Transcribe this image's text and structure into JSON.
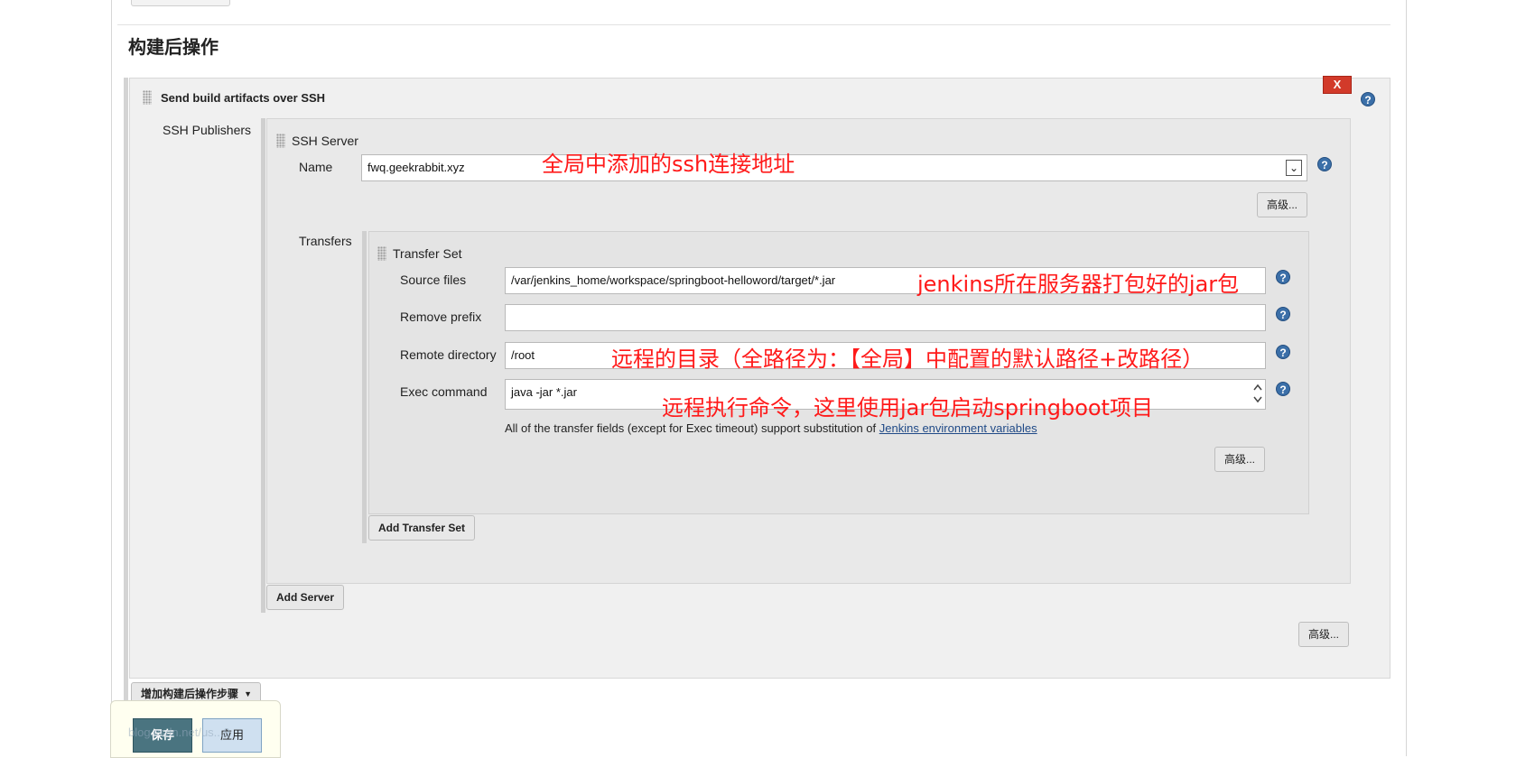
{
  "section": {
    "title": "构建后操作"
  },
  "step": {
    "title": "Send build artifacts over SSH",
    "delete_label": "X"
  },
  "publishers": {
    "label": "SSH Publishers"
  },
  "server": {
    "header": "SSH Server",
    "name_label": "Name",
    "name_value": "fwq.geekrabbit.xyz",
    "advanced_label": "高级..."
  },
  "transfers": {
    "label": "Transfers",
    "set_header": "Transfer Set",
    "source_files_label": "Source files",
    "source_files_value": "/var/jenkins_home/workspace/springboot-helloword/target/*.jar",
    "remove_prefix_label": "Remove prefix",
    "remove_prefix_value": "",
    "remote_directory_label": "Remote directory",
    "remote_directory_value": "/root",
    "exec_command_label": "Exec command",
    "exec_command_value": "java -jar *.jar",
    "note_text": "All of the transfer fields (except for Exec timeout) support substitution of ",
    "note_link": "Jenkins environment variables",
    "advanced_label": "高级...",
    "add_transfer_set_label": "Add Transfer Set"
  },
  "add_server_label": "Add Server",
  "step_advanced_label": "高级...",
  "add_post_build_label": "增加构建后操作步骤",
  "footer": {
    "save_label": "保存",
    "apply_label": "应用",
    "watermark": "blog.csdn.net/us...9"
  },
  "annotations": {
    "name_note": "全局中添加的ssh连接地址",
    "source_note": "jenkins所在服务器打包好的jar包",
    "remote_note": "远程的目录（全路径为：【全局】中配置的默认路径+改路径）",
    "exec_note": "远程执行命令，这里使用jar包启动springboot项目"
  },
  "icons": {
    "help": "help-icon",
    "grip": "drag-handle-icon",
    "dropdown": "chevron-down-icon",
    "spinner": "spinner-arrows-icon"
  },
  "colors": {
    "annotation": "#ff1a1a",
    "delete": "#d23a2a",
    "save": "#4a7480",
    "help": "#3b6fa8"
  }
}
